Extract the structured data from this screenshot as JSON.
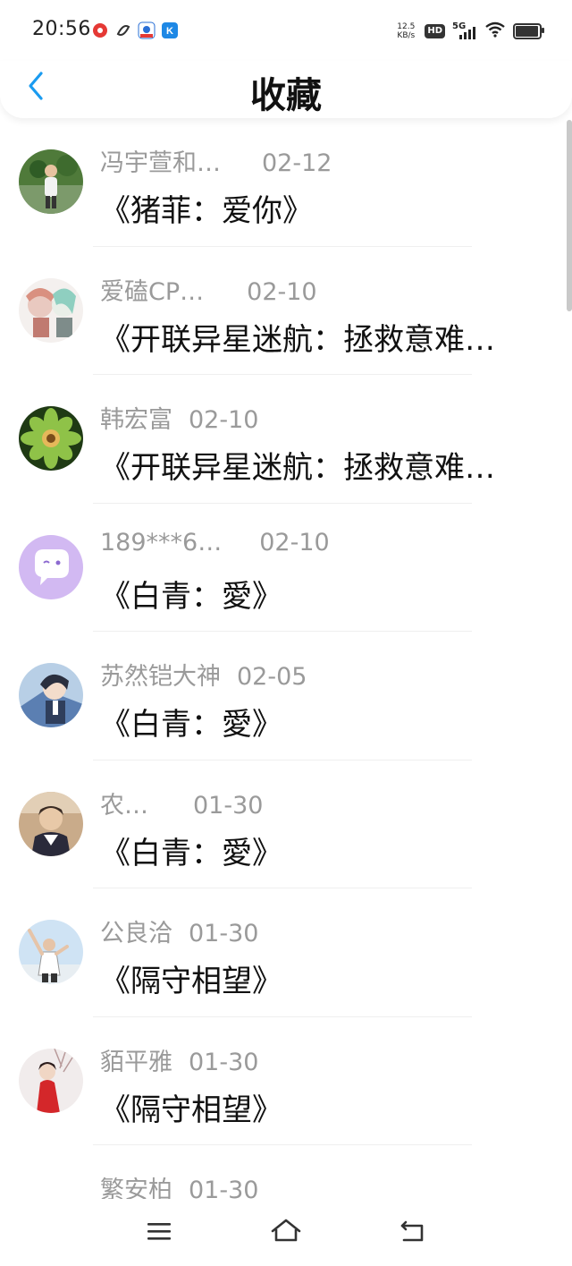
{
  "status_bar": {
    "time": "20:56",
    "apps": [
      "red-app-icon",
      "swirl-app-icon",
      "blue-app-icon",
      "kugou-app-icon"
    ],
    "net_speed_value": "12.5",
    "net_speed_unit": "KB/s",
    "hd_label": "HD",
    "network_label": "5G"
  },
  "header": {
    "title": "收藏",
    "back_icon": "chevron-left-icon",
    "accent_color": "#1a9bf0"
  },
  "favorites": [
    {
      "user": "冯宇萱和…",
      "date": "02-12",
      "topic": "《猪菲：爱你》"
    },
    {
      "user": "爱磕CP…",
      "date": "02-10",
      "topic": "《开联异星迷航：拯救意难…"
    },
    {
      "user": "韩宏富",
      "date": "02-10",
      "topic": "《开联异星迷航：拯救意难…"
    },
    {
      "user": "189***6…",
      "date": "02-10",
      "topic": "《白青：愛》"
    },
    {
      "user": "苏然铠大神",
      "date": "02-05",
      "topic": "《白青：愛》"
    },
    {
      "user": "农…",
      "date": "01-30",
      "topic": "《白青：愛》"
    },
    {
      "user": "公良洽",
      "date": "01-30",
      "topic": "《隔守相望》"
    },
    {
      "user": "貊平雅",
      "date": "01-30",
      "topic": "《隔守相望》"
    },
    {
      "user": "繁安柏",
      "date": "01-30",
      "topic": ""
    }
  ],
  "nav": {
    "menu_icon": "menu-icon",
    "home_icon": "home-icon",
    "back_icon": "back-arrow-icon"
  }
}
